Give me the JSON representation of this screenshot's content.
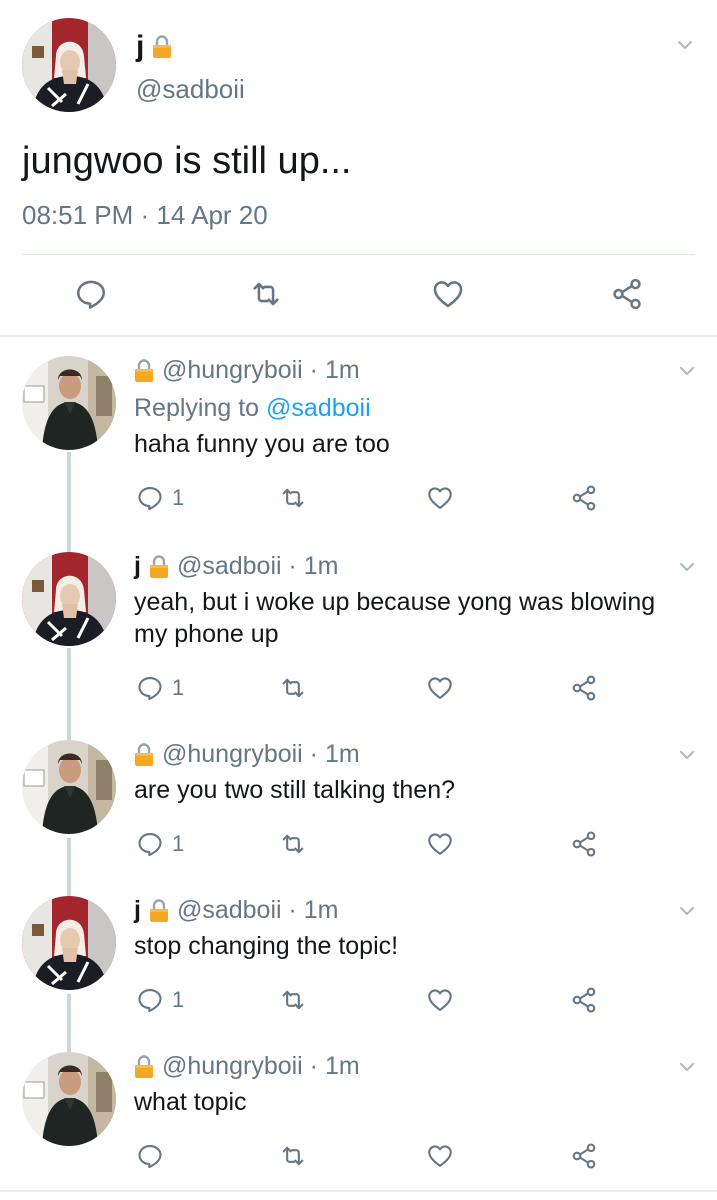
{
  "main_tweet": {
    "display_name": "j",
    "handle": "@sadboii",
    "text": "jungwoo is still up...",
    "timestamp": "08:51 PM · 14 Apr 20",
    "icons": {
      "lock": "lock-icon",
      "more": "chevron-down-icon",
      "reply": "reply-icon",
      "retweet": "retweet-icon",
      "like": "heart-icon",
      "share": "share-icon"
    }
  },
  "replies": [
    {
      "display_name": "",
      "handle": "@hungryboii · 1m",
      "replying_prefix": "Replying to ",
      "replying_to": "@sadboii",
      "text": "haha funny you are too",
      "reply_count": "1"
    },
    {
      "display_name": "j",
      "handle": "@sadboii · 1m",
      "text": "yeah, but i woke up because yong was blowing my phone up",
      "reply_count": "1"
    },
    {
      "display_name": "",
      "handle": "@hungryboii · 1m",
      "text": "are you two still talking then?",
      "reply_count": "1"
    },
    {
      "display_name": "j",
      "handle": "@sadboii · 1m",
      "text": "stop changing the topic!",
      "reply_count": "1"
    },
    {
      "display_name": "",
      "handle": "@hungryboii · 1m",
      "text": "what topic",
      "reply_count": ""
    }
  ],
  "colors": {
    "text_primary": "#14171a",
    "text_secondary": "#657786",
    "link": "#1da1f2",
    "divider": "#e1e8ed",
    "thread_line": "#ccd6dd",
    "lock": "#f5a623"
  }
}
